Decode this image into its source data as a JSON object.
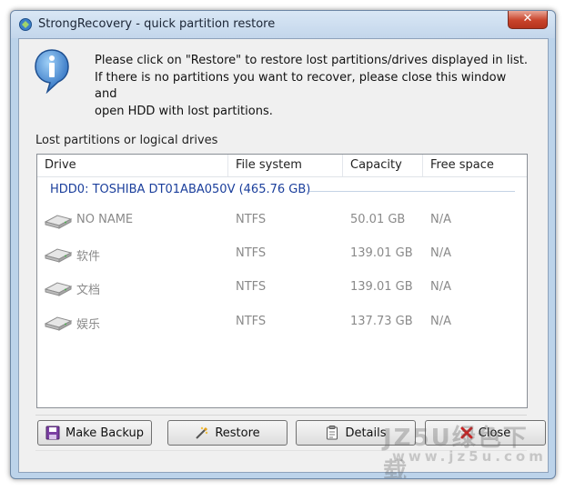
{
  "window": {
    "title": "StrongRecovery - quick partition restore",
    "close_glyph": "✕"
  },
  "instruction": {
    "text": "Please click on \"Restore\" to restore lost partitions/drives displayed in list.\nIf there is no partitions you want to recover, please close this window and\nopen HDD with lost partitions.",
    "icon": "info-icon"
  },
  "list": {
    "label": "Lost partitions or logical drives",
    "columns": [
      "Drive",
      "File system",
      "Capacity",
      "Free space"
    ],
    "group": "HDD0: TOSHIBA DT01ABA050V (465.76 GB)",
    "rows": [
      {
        "drive": "NO NAME",
        "fs": "NTFS",
        "capacity": "50.01 GB",
        "free": "N/A"
      },
      {
        "drive": "软件",
        "fs": "NTFS",
        "capacity": "139.01 GB",
        "free": "N/A"
      },
      {
        "drive": "文档",
        "fs": "NTFS",
        "capacity": "139.01 GB",
        "free": "N/A"
      },
      {
        "drive": "娱乐",
        "fs": "NTFS",
        "capacity": "137.73 GB",
        "free": "N/A"
      }
    ]
  },
  "buttons": {
    "backup": "Make Backup",
    "restore": "Restore",
    "details": "Details",
    "close": "Close"
  },
  "watermark": {
    "line1": "JZ5U绿色下载",
    "line2": "www.jz5u.com"
  },
  "colors": {
    "group_text": "#1b3f9c",
    "row_text": "#8a8a8a",
    "frame": "#bcd3ea"
  }
}
